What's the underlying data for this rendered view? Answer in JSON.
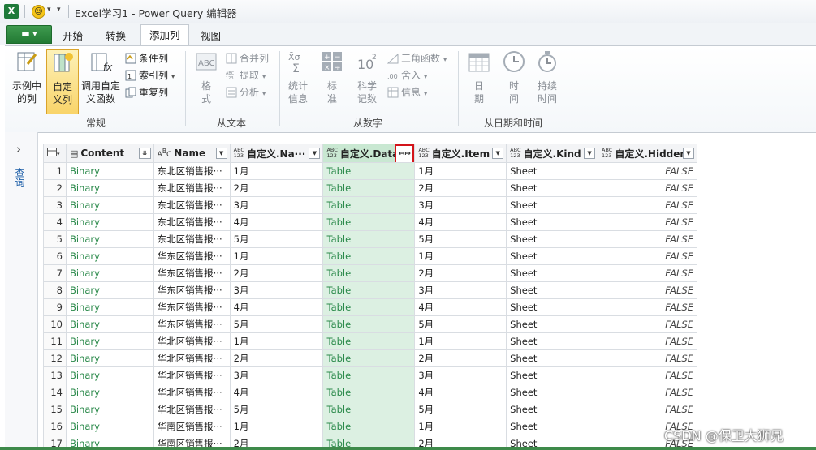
{
  "window": {
    "title": "Excel学习1 - Power Query 编辑器",
    "app_badge": "X"
  },
  "tabs": {
    "file": "▬ ▾",
    "items": [
      "开始",
      "转换",
      "添加列",
      "视图"
    ],
    "active_index": 2
  },
  "ribbon": {
    "groups": {
      "general": {
        "label": "常规",
        "example_col": "示例中\n的列",
        "custom_col": "自定\n义列",
        "invoke_func": "调用自定\n义函数",
        "conditional_col": "条件列",
        "index_col": "索引列",
        "duplicate_col": "重复列"
      },
      "from_text": {
        "label": "从文本",
        "format": "格\n式",
        "merge_cols": "合并列",
        "extract": "提取",
        "parse": "分析"
      },
      "from_number": {
        "label": "从数字",
        "statistics": "统计\n信息",
        "standard": "标\n准",
        "scientific": "科学\n记数",
        "trig": "三角函数",
        "rounding": "舍入",
        "info": "信息"
      },
      "from_datetime": {
        "label": "从日期和时间",
        "date": "日\n期",
        "time": "时\n间",
        "duration": "持续\n时间"
      }
    }
  },
  "leftnav": {
    "label": "查询"
  },
  "grid": {
    "columns": [
      {
        "name": "Content",
        "type": "doc"
      },
      {
        "name": "Name",
        "type": "ABC"
      },
      {
        "name": "自定义.Na···",
        "type": "ABC 123"
      },
      {
        "name": "自定义.Data",
        "type": "ABC 123"
      },
      {
        "name": "自定义.Item",
        "type": "ABC 123"
      },
      {
        "name": "自定义.Kind",
        "type": "ABC 123"
      },
      {
        "name": "自定义.Hidden",
        "type": "ABC 123"
      }
    ],
    "rows": [
      [
        "1",
        "Binary",
        "东北区销售报···",
        "1月",
        "Table",
        "1月",
        "Sheet",
        "FALSE"
      ],
      [
        "2",
        "Binary",
        "东北区销售报···",
        "2月",
        "Table",
        "2月",
        "Sheet",
        "FALSE"
      ],
      [
        "3",
        "Binary",
        "东北区销售报···",
        "3月",
        "Table",
        "3月",
        "Sheet",
        "FALSE"
      ],
      [
        "4",
        "Binary",
        "东北区销售报···",
        "4月",
        "Table",
        "4月",
        "Sheet",
        "FALSE"
      ],
      [
        "5",
        "Binary",
        "东北区销售报···",
        "5月",
        "Table",
        "5月",
        "Sheet",
        "FALSE"
      ],
      [
        "6",
        "Binary",
        "华东区销售报···",
        "1月",
        "Table",
        "1月",
        "Sheet",
        "FALSE"
      ],
      [
        "7",
        "Binary",
        "华东区销售报···",
        "2月",
        "Table",
        "2月",
        "Sheet",
        "FALSE"
      ],
      [
        "8",
        "Binary",
        "华东区销售报···",
        "3月",
        "Table",
        "3月",
        "Sheet",
        "FALSE"
      ],
      [
        "9",
        "Binary",
        "华东区销售报···",
        "4月",
        "Table",
        "4月",
        "Sheet",
        "FALSE"
      ],
      [
        "10",
        "Binary",
        "华东区销售报···",
        "5月",
        "Table",
        "5月",
        "Sheet",
        "FALSE"
      ],
      [
        "11",
        "Binary",
        "华北区销售报···",
        "1月",
        "Table",
        "1月",
        "Sheet",
        "FALSE"
      ],
      [
        "12",
        "Binary",
        "华北区销售报···",
        "2月",
        "Table",
        "2月",
        "Sheet",
        "FALSE"
      ],
      [
        "13",
        "Binary",
        "华北区销售报···",
        "3月",
        "Table",
        "3月",
        "Sheet",
        "FALSE"
      ],
      [
        "14",
        "Binary",
        "华北区销售报···",
        "4月",
        "Table",
        "4月",
        "Sheet",
        "FALSE"
      ],
      [
        "15",
        "Binary",
        "华北区销售报···",
        "5月",
        "Table",
        "5月",
        "Sheet",
        "FALSE"
      ],
      [
        "16",
        "Binary",
        "华南区销售报···",
        "1月",
        "Table",
        "1月",
        "Sheet",
        "FALSE"
      ],
      [
        "17",
        "Binary",
        "华南区销售报···",
        "2月",
        "Table",
        "2月",
        "Sheet",
        "FALSE"
      ]
    ]
  },
  "watermark": "CSDN @保卫大狮兄",
  "colors": {
    "accent_green": "#227a33",
    "selected_col": "#dcf0e2",
    "highlight_red": "#d3141a"
  }
}
